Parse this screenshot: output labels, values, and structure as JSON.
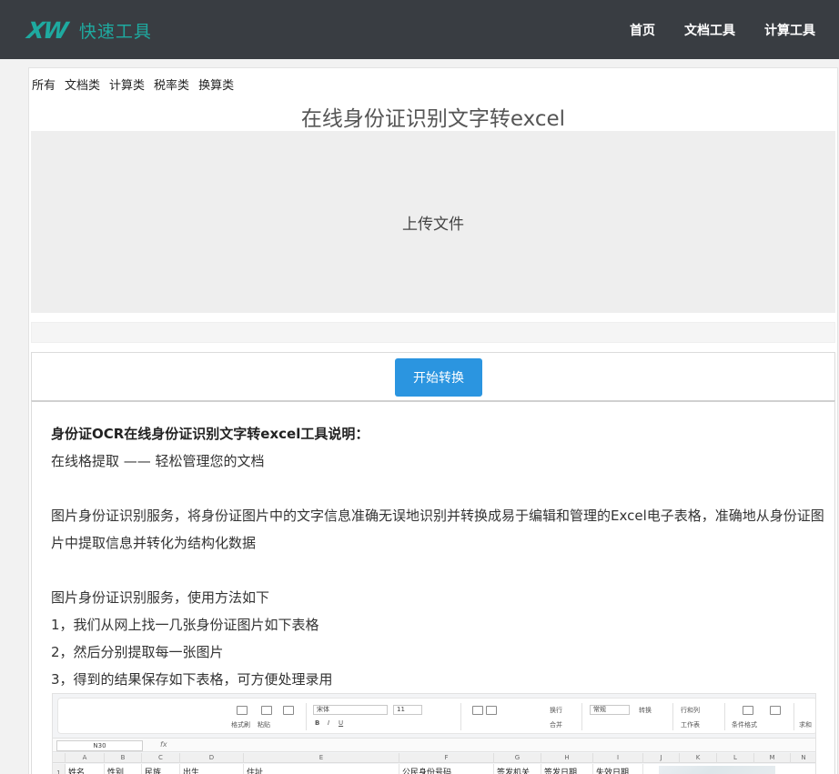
{
  "header": {
    "logo_mark": "XW",
    "logo_text": "快速工具",
    "nav": [
      "首页",
      "文档工具",
      "计算工具"
    ]
  },
  "categories": [
    "所有",
    "文档类",
    "计算类",
    "税率类",
    "换算类"
  ],
  "page_title": "在线身份证识别文字转excel",
  "upload": {
    "label": "上传文件"
  },
  "progress": {
    "value": 0
  },
  "convert_button": "开始转换",
  "description": {
    "title": "身份证OCR在线身份证识别文字转excel工具说明：",
    "subtitle": "在线格提取 —— 轻松管理您的文档",
    "intro": "图片身份证识别服务，将身份证图片中的文字信息准确无误地识别并转换成易于编辑和管理的Excel电子表格，准确地从身份证图片中提取信息并转化为结构化数据",
    "usage_heading": "图片身份证识别服务，使用方法如下",
    "steps": [
      "1，我们从网上找一几张身份证图片如下表格",
      "2，然后分别提取每一张图片",
      "3，得到的结果保存如下表格，可方便处理录用"
    ]
  },
  "spreadsheet": {
    "name_box": "N30",
    "fx": "fx",
    "font_name": "宋体",
    "font_size": "11",
    "number_format": "常规",
    "toolbar_labels": [
      "格式刷",
      "粘贴",
      "换行",
      "合并",
      "转换",
      "行和列",
      "工作表",
      "条件格式",
      "求和"
    ],
    "columns": [
      "A",
      "B",
      "C",
      "D",
      "E",
      "F",
      "G",
      "H",
      "I",
      "J",
      "K",
      "L",
      "M",
      "N"
    ],
    "row_number": "1",
    "header_row": [
      "姓名",
      "性别",
      "民族",
      "出生",
      "住址",
      "公民身份号码",
      "签发机关",
      "签发日期",
      "失效日期"
    ]
  }
}
